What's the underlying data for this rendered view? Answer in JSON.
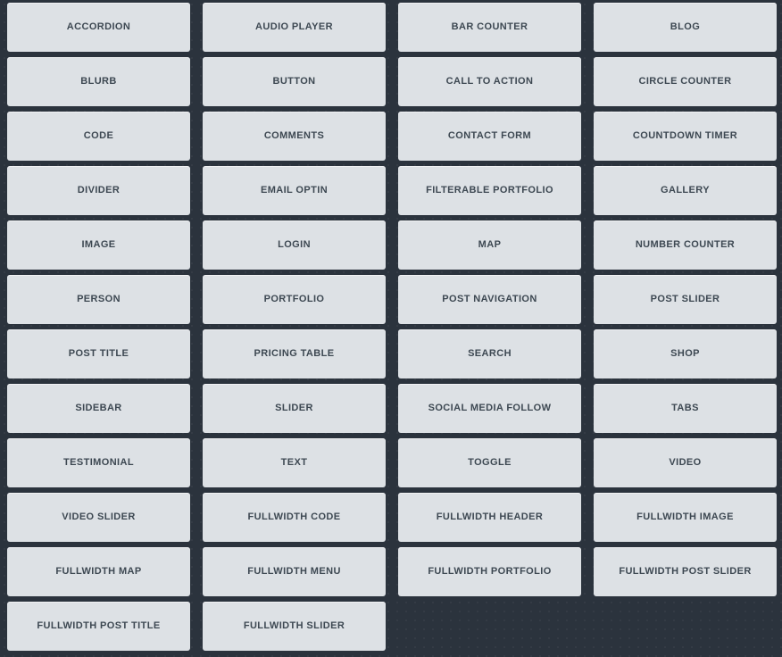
{
  "theme": {
    "background_color": "#2b333d",
    "tile_color": "#dde1e5",
    "tile_text_color": "#3d4852",
    "dot_pattern_color": "rgba(255,255,255,0.055)"
  },
  "grid": {
    "columns": 4,
    "rows": 12,
    "total_tiles": 46
  },
  "modules": [
    {
      "label": "ACCORDION"
    },
    {
      "label": "AUDIO PLAYER"
    },
    {
      "label": "BAR COUNTER"
    },
    {
      "label": "BLOG"
    },
    {
      "label": "BLURB"
    },
    {
      "label": "BUTTON"
    },
    {
      "label": "CALL TO ACTION"
    },
    {
      "label": "CIRCLE COUNTER"
    },
    {
      "label": "CODE"
    },
    {
      "label": "COMMENTS"
    },
    {
      "label": "CONTACT FORM"
    },
    {
      "label": "COUNTDOWN TIMER"
    },
    {
      "label": "DIVIDER"
    },
    {
      "label": "EMAIL OPTIN"
    },
    {
      "label": "FILTERABLE PORTFOLIO"
    },
    {
      "label": "GALLERY"
    },
    {
      "label": "IMAGE"
    },
    {
      "label": "LOGIN"
    },
    {
      "label": "MAP"
    },
    {
      "label": "NUMBER COUNTER"
    },
    {
      "label": "PERSON"
    },
    {
      "label": "PORTFOLIO"
    },
    {
      "label": "POST NAVIGATION"
    },
    {
      "label": "POST SLIDER"
    },
    {
      "label": "POST TITLE"
    },
    {
      "label": "PRICING TABLE"
    },
    {
      "label": "SEARCH"
    },
    {
      "label": "SHOP"
    },
    {
      "label": "SIDEBAR"
    },
    {
      "label": "SLIDER"
    },
    {
      "label": "SOCIAL MEDIA FOLLOW"
    },
    {
      "label": "TABS"
    },
    {
      "label": "TESTIMONIAL"
    },
    {
      "label": "TEXT"
    },
    {
      "label": "TOGGLE"
    },
    {
      "label": "VIDEO"
    },
    {
      "label": "VIDEO SLIDER"
    },
    {
      "label": "FULLWIDTH CODE"
    },
    {
      "label": "FULLWIDTH HEADER"
    },
    {
      "label": "FULLWIDTH IMAGE"
    },
    {
      "label": "FULLWIDTH MAP"
    },
    {
      "label": "FULLWIDTH MENU"
    },
    {
      "label": "FULLWIDTH PORTFOLIO"
    },
    {
      "label": "FULLWIDTH POST SLIDER"
    },
    {
      "label": "FULLWIDTH POST TITLE"
    },
    {
      "label": "FULLWIDTH SLIDER"
    }
  ]
}
